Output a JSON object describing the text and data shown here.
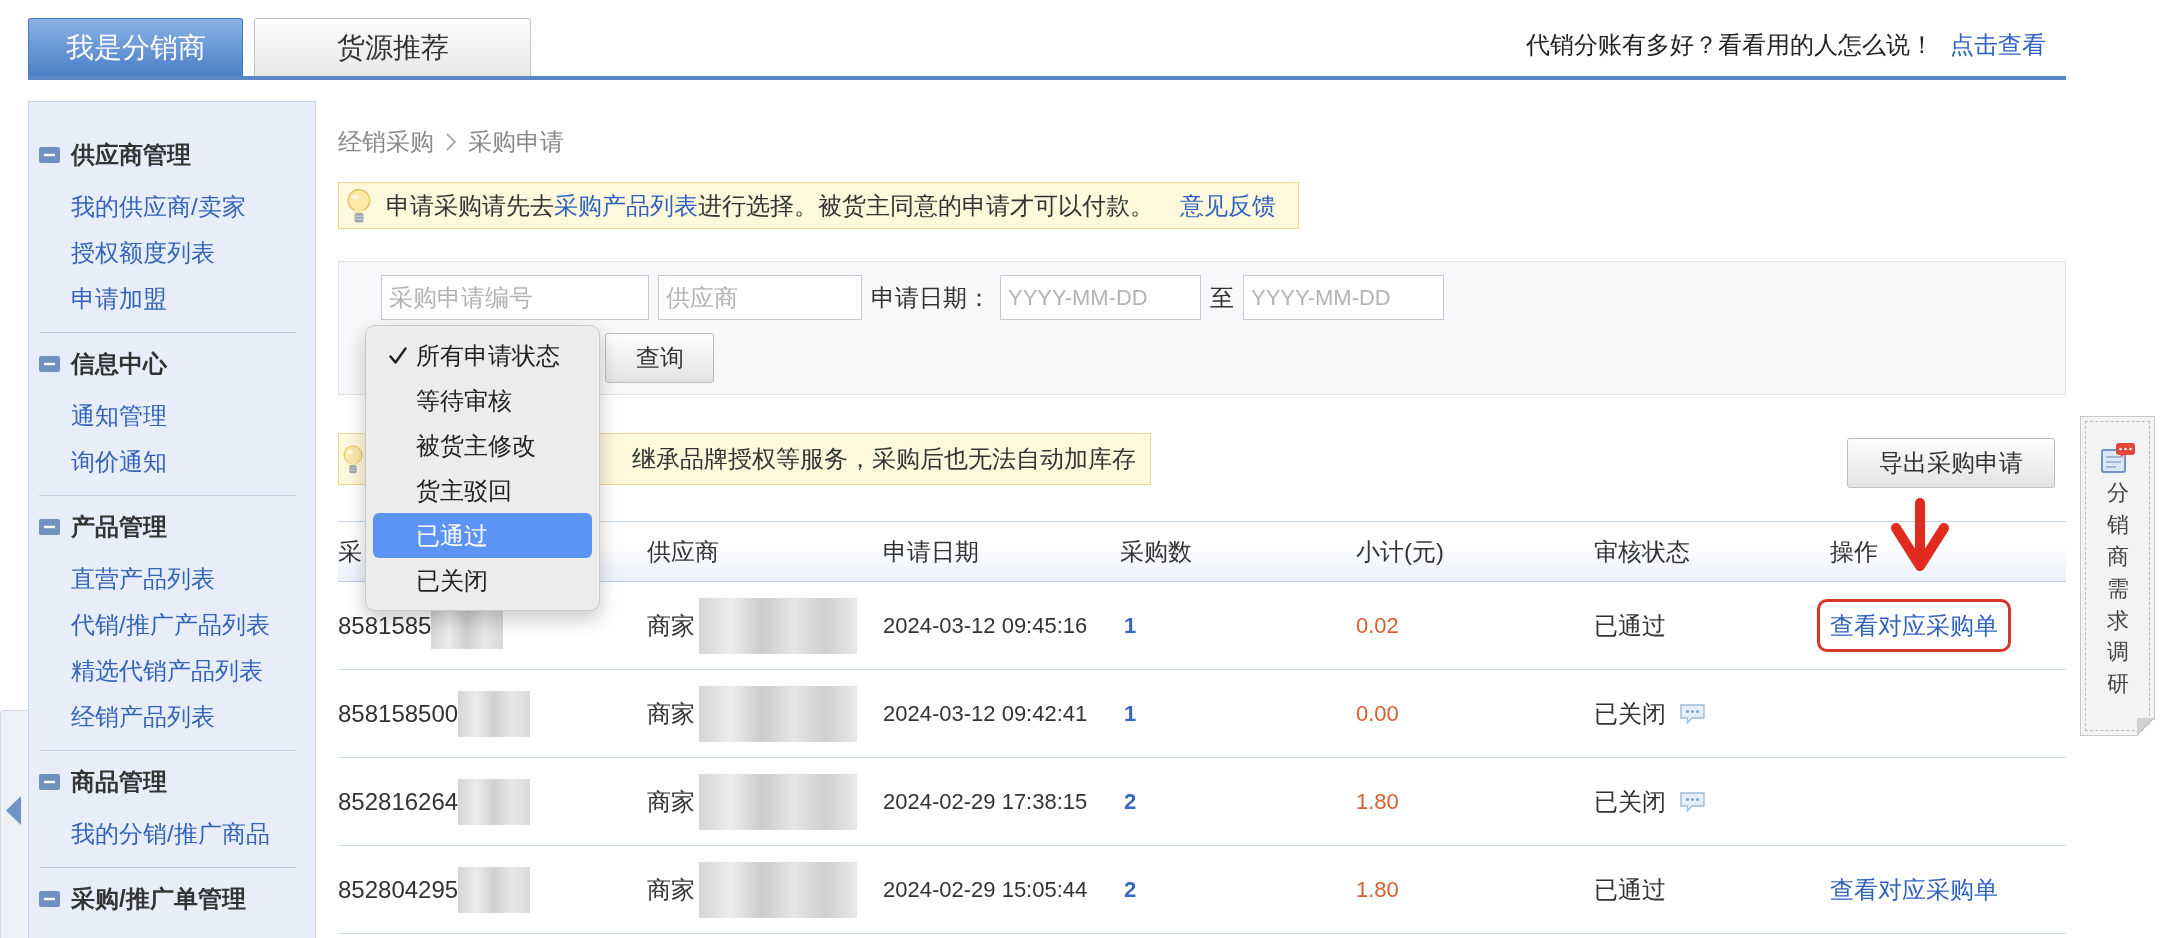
{
  "tabs": [
    {
      "label": "我是分销商",
      "selected": true
    },
    {
      "label": "货源推荐",
      "selected": false
    }
  ],
  "promo": {
    "text": "代销分账有多好？看看用的人怎么说！",
    "link": "点击查看"
  },
  "sidebar": {
    "sections": [
      {
        "title": "供应商管理",
        "expanded": true,
        "items": [
          "我的供应商/卖家",
          "授权额度列表",
          "申请加盟"
        ]
      },
      {
        "title": "信息中心",
        "expanded": true,
        "items": [
          "通知管理",
          "询价通知"
        ]
      },
      {
        "title": "产品管理",
        "expanded": true,
        "items": [
          "直营产品列表",
          "代销/推广产品列表",
          "精选代销产品列表",
          "经销产品列表"
        ]
      },
      {
        "title": "商品管理",
        "expanded": true,
        "items": [
          "我的分销/推广商品"
        ]
      },
      {
        "title": "采购/推广单管理",
        "expanded": true
      }
    ]
  },
  "breadcrumb": [
    "经销采购",
    "采购申请"
  ],
  "notice": {
    "parts": [
      {
        "kind": "text",
        "text": "申请采购请先去"
      },
      {
        "kind": "link",
        "text": "采购产品列表"
      },
      {
        "kind": "text",
        "text": "进行选择。被货主同意的申请才可以付款。"
      }
    ],
    "link": "意见反馈"
  },
  "filter": {
    "fields": [
      {
        "kind": "input",
        "placeholder": "采购申请编号"
      },
      {
        "kind": "input",
        "placeholder": "供应商"
      },
      {
        "kind": "label",
        "text": "申请日期："
      },
      {
        "kind": "date",
        "placeholder": "YYYY-MM-DD"
      },
      {
        "kind": "label",
        "text": "至"
      },
      {
        "kind": "date",
        "placeholder": "YYYY-MM-DD"
      }
    ],
    "status_menu": {
      "options": [
        {
          "label": "所有申请状态",
          "checked": true,
          "selected": false
        },
        {
          "label": "等待审核",
          "checked": false,
          "selected": false
        },
        {
          "label": "被货主修改",
          "checked": false,
          "selected": false
        },
        {
          "label": "货主驳回",
          "checked": false,
          "selected": false
        },
        {
          "label": "已通过",
          "checked": false,
          "selected": true
        },
        {
          "label": "已关闭",
          "checked": false,
          "selected": false
        }
      ]
    },
    "button": "查询"
  },
  "tip": {
    "text": "继承品牌授权等服务，采购后也无法自动加库存"
  },
  "export_button": "导出采购申请",
  "table": {
    "columns": [
      "采",
      "供应商",
      "申请日期",
      "采购数",
      "小计(元)",
      "审核状态",
      "操作"
    ],
    "rows": [
      {
        "order_no": "8581585",
        "order_no_redacted": true,
        "supplier": "商家",
        "supplier_redacted": true,
        "date": "2024-03-12 09:45:16",
        "quantity": "1",
        "subtotal": "0.02",
        "status": "已通过",
        "has_comment": false,
        "action": {
          "label": "查看对应采购单",
          "highlighted": true
        }
      },
      {
        "order_no": "858158500",
        "order_no_redacted": true,
        "supplier": "商家",
        "supplier_redacted": true,
        "date": "2024-03-12 09:42:41",
        "quantity": "1",
        "subtotal": "0.00",
        "status": "已关闭",
        "has_comment": true
      },
      {
        "order_no": "852816264",
        "order_no_redacted": true,
        "supplier": "商家",
        "supplier_redacted": true,
        "date": "2024-02-29 17:38:15",
        "quantity": "2",
        "subtotal": "1.80",
        "status": "已关闭",
        "has_comment": true
      },
      {
        "order_no": "852804295",
        "order_no_redacted": true,
        "supplier": "商家",
        "supplier_redacted": true,
        "date": "2024-02-29 15:05:44",
        "quantity": "2",
        "subtotal": "1.80",
        "status": "已通过",
        "has_comment": false,
        "action": {
          "label": "查看对应采购单",
          "highlighted": false
        }
      }
    ]
  },
  "survey_tab": {
    "label": "分销商需求调研"
  }
}
